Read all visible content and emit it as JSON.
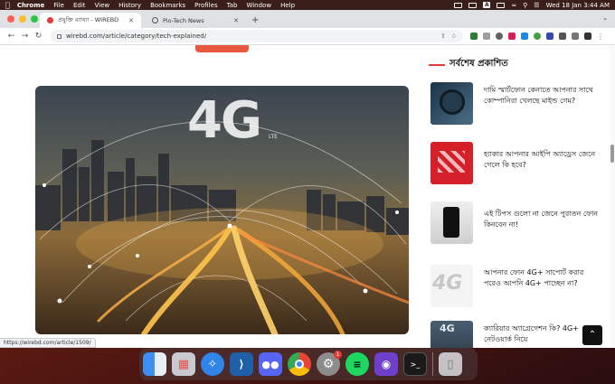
{
  "menubar": {
    "app": "Chrome",
    "menus": [
      "File",
      "Edit",
      "View",
      "History",
      "Bookmarks",
      "Profiles",
      "Tab",
      "Window",
      "Help"
    ],
    "clock": "Wed 18 Jan  3:44 AM",
    "status_a": "A"
  },
  "browser": {
    "tabs": [
      {
        "title": "প্রযুক্তি ব্যাখ্যা - WIREBD",
        "active": true
      },
      {
        "title": "Pio-Tech News",
        "active": false
      }
    ],
    "address": "wirebd.com/article/category/tech-explained/",
    "status_url": "https://wirebd.com/article/1509/"
  },
  "page": {
    "hero": {
      "big_text": "4G",
      "sub_text": "LTE"
    },
    "sidebar": {
      "heading": "সর্বশেষ প্রকাশিত",
      "posts": [
        {
          "title": "দামি স্মার্টফোন কেনাতে আপনার সাথে কোম্পানিরা খেলছে মাইন্ড গেম?"
        },
        {
          "title": "হ্যাকার আপনার আইপি অ্যাড্রেস জেনে গেলে কি হবে?"
        },
        {
          "title": "এই টিপস গুলো না জেনে পুরাতন ফোন কিনবেন না!"
        },
        {
          "title": "আপনার ফোন 4G+ সাপোর্ট করার পরেও আপনি 4G+ পাচ্ছেন না?"
        },
        {
          "title": "ক্যারিয়ার অ্যাগ্রেগেশন কি? 4G+ নেটওয়ার্ক নিয়ে"
        }
      ],
      "thumb4_text": "4G",
      "thumb5_text": "4G"
    }
  },
  "dock": {
    "apps": [
      "finder",
      "launchpad",
      "safari",
      "vscode",
      "discord",
      "chrome",
      "system-preferences",
      "spotify",
      "github-desktop",
      "terminal",
      "trash"
    ],
    "badge": "1"
  },
  "colors": {
    "accent": "#e53935",
    "sidebar_bar": "#e53935"
  }
}
